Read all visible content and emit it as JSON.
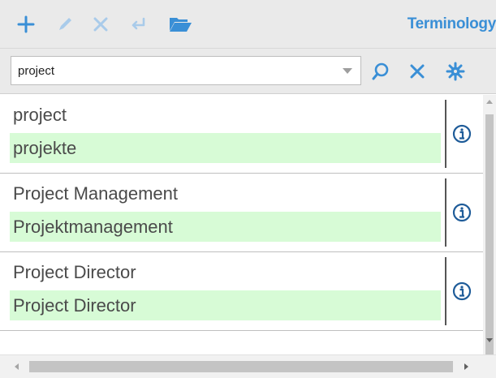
{
  "toolbar": {
    "title": "Terminology",
    "icons": [
      "add-icon",
      "edit-icon",
      "delete-icon",
      "enter-icon",
      "open-folder-icon"
    ]
  },
  "search": {
    "value": "project",
    "icons": [
      "search-icon",
      "clear-icon",
      "settings-icon"
    ]
  },
  "entries": [
    {
      "source": "project",
      "target": "projekte"
    },
    {
      "source": "Project Management",
      "target": "Projektmanagement"
    },
    {
      "source": "Project Director",
      "target": "Project Director"
    }
  ],
  "colors": {
    "accent": "#3a8fd6",
    "target_highlight": "#d7fbd6",
    "toolbar_bg": "#eaeaea"
  }
}
